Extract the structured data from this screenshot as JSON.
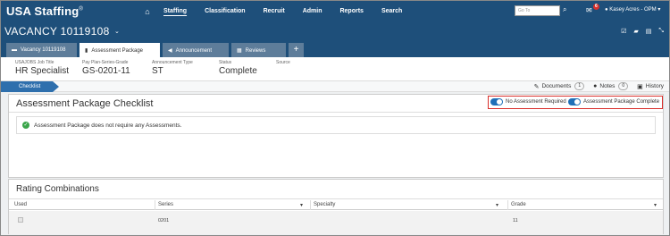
{
  "app": {
    "logo_text": "USA Staffing",
    "logo_mark": "®"
  },
  "nav": {
    "items": [
      "Staffing",
      "Classification",
      "Recruit",
      "Admin",
      "Reports",
      "Search"
    ],
    "active": "Staffing",
    "goto_placeholder": "Go To",
    "mail_badge": "6",
    "user_name": "Kasey Acres - OPM"
  },
  "vacancy": {
    "title": "VACANCY 10119108"
  },
  "tabs": [
    {
      "label": "Vacancy 10119108",
      "icon": "folder-icon"
    },
    {
      "label": "Assessment Package",
      "icon": "document-icon",
      "active": true
    },
    {
      "label": "Announcement",
      "icon": "megaphone-icon"
    },
    {
      "label": "Reviews",
      "icon": "reviews-icon"
    }
  ],
  "info": {
    "job_title_label": "USAJOBS Job Title",
    "job_title": "HR Specialist",
    "ppsg_label": "Pay Plan-Series-Grade",
    "ppsg": "GS-0201-11",
    "ann_type_label": "Announcement Type",
    "ann_type": "ST",
    "status_label": "Status",
    "status": "Complete",
    "source_label": "Source",
    "source": ""
  },
  "strip": {
    "checklist": "Checklist",
    "documents": "Documents",
    "documents_count": "1",
    "notes": "Notes",
    "notes_count": "0",
    "history": "History"
  },
  "checklist": {
    "title": "Assessment Package Checklist",
    "toggle1": "No Assessment Required",
    "toggle2": "Assessment Package Complete",
    "toggle1_on": true,
    "toggle2_on": true,
    "message": "Assessment Package does not require any Assessments."
  },
  "rating": {
    "title": "Rating Combinations",
    "columns": [
      "Used",
      "Series",
      "Specialty",
      "Grade"
    ],
    "rows": [
      {
        "used": false,
        "series": "0201",
        "specialty": "",
        "grade": "11"
      }
    ]
  },
  "colors": {
    "navy": "#1e4f7a",
    "tab_inactive": "#5e7d9a",
    "accent_blue": "#2e6fad",
    "highlight_red": "#d9302c",
    "success_green": "#3aa54a"
  }
}
